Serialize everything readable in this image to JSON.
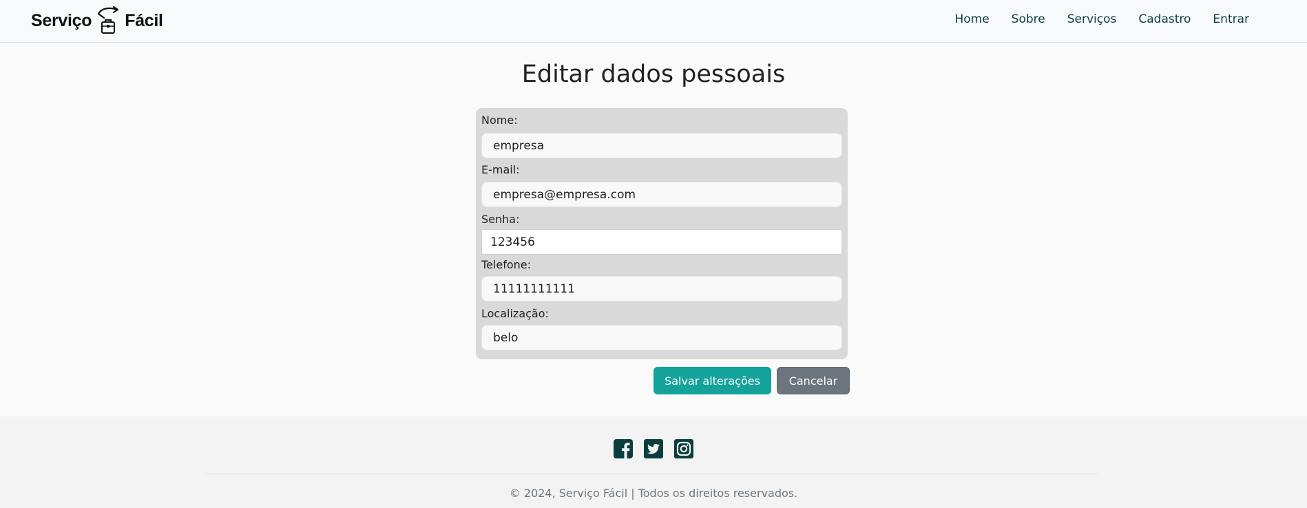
{
  "brand": {
    "name_left": "Serviço",
    "name_right": "Fácil"
  },
  "nav": {
    "items": [
      {
        "label": "Home"
      },
      {
        "label": "Sobre"
      },
      {
        "label": "Serviços"
      },
      {
        "label": "Cadastro"
      },
      {
        "label": "Entrar"
      }
    ]
  },
  "page": {
    "title": "Editar dados pessoais"
  },
  "form": {
    "name": {
      "label": "Nome:",
      "value": "empresa"
    },
    "email": {
      "label": "E-mail:",
      "value": "empresa@empresa.com"
    },
    "password": {
      "label": "Senha:",
      "value": "123456"
    },
    "phone": {
      "label": "Telefone:",
      "value": "11111111111"
    },
    "location": {
      "label": "Localização:",
      "value": "belo"
    }
  },
  "actions": {
    "save_label": "Salvar alterações",
    "cancel_label": "Cancelar"
  },
  "footer": {
    "social_icons": [
      "facebook-icon",
      "twitter-icon",
      "instagram-icon"
    ],
    "copyright": "© 2024, Serviço Fácil | Todos os direitos reservados."
  },
  "colors": {
    "primary": "#14a39a",
    "nav_text": "#0b3d3d",
    "social_icon": "#0b3d3d",
    "cancel": "#6c757d",
    "form_bg": "#d9d9d9"
  }
}
